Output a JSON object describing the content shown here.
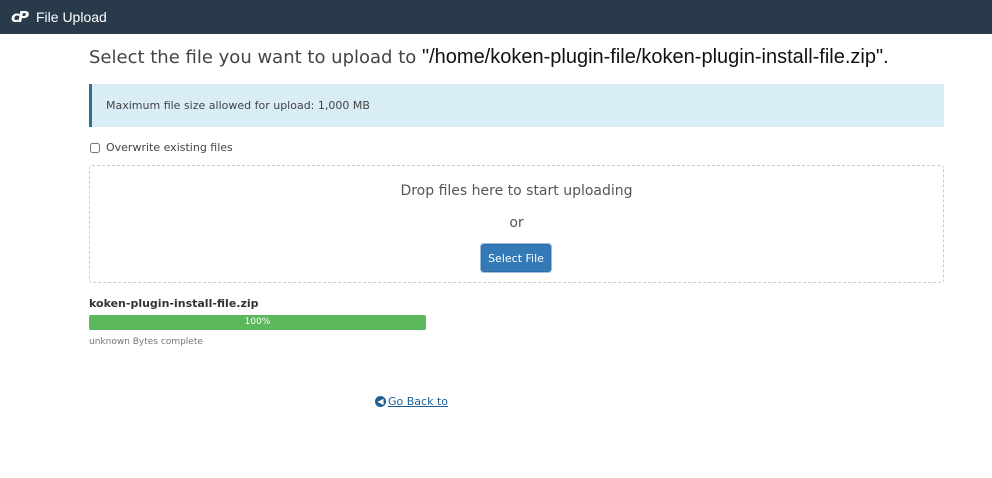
{
  "header": {
    "logo_text": "cP",
    "title": "File Upload"
  },
  "heading": {
    "prefix": "Select the file you want to upload to ",
    "path": "\"/home/koken-plugin-file/koken-plugin-install-file.zip\"",
    "suffix": "."
  },
  "alert": {
    "text": "Maximum file size allowed for upload: 1,000 MB"
  },
  "options": {
    "overwrite_label": "Overwrite existing files",
    "overwrite_checked": false
  },
  "dropzone": {
    "drop_text": "Drop files here to start uploading",
    "or_text": "or",
    "select_button": "Select File"
  },
  "upload": {
    "file_name": "koken-plugin-install-file.zip",
    "progress_label": "100%",
    "progress_percent": 100,
    "status": "unknown Bytes complete"
  },
  "footer": {
    "go_back_label": "Go Back to"
  },
  "colors": {
    "header_bg": "#293a4a",
    "alert_bg": "#d9edf7",
    "primary": "#337ab7",
    "progress": "#5cb85c",
    "link": "#1f5f99"
  }
}
